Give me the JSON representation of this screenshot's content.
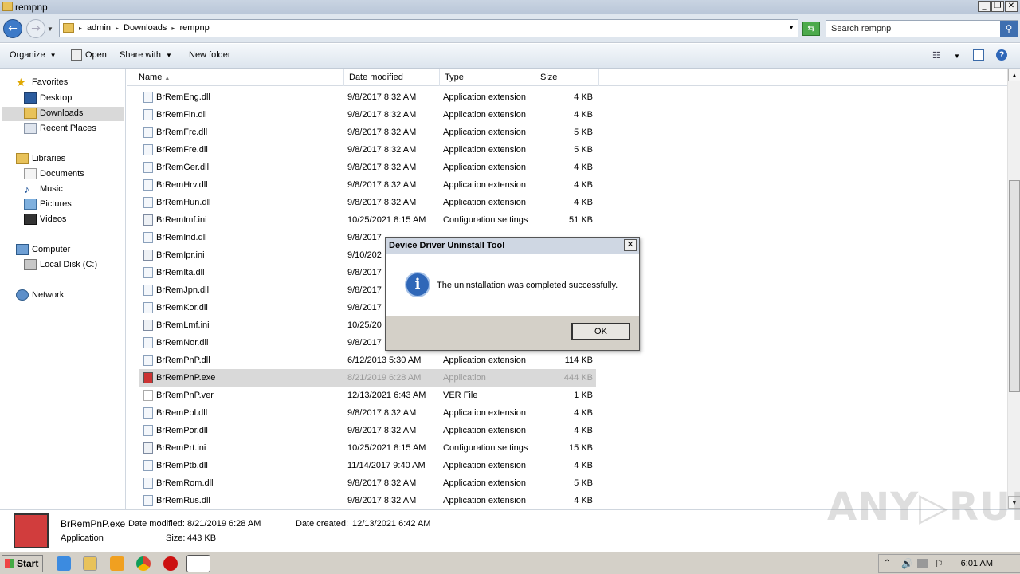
{
  "window": {
    "title": "rempnp",
    "controls": {
      "minimize": "_",
      "maximize": "❐",
      "close": "✕"
    }
  },
  "address": {
    "crumbs": [
      "admin",
      "Downloads",
      "rempnp"
    ],
    "search_placeholder": "Search rempnp"
  },
  "toolbar": {
    "organize": "Organize",
    "open": "Open",
    "share_with": "Share with",
    "new_folder": "New folder"
  },
  "sidebar": {
    "favorites": "Favorites",
    "desktop": "Desktop",
    "downloads": "Downloads",
    "recent": "Recent Places",
    "libraries": "Libraries",
    "documents": "Documents",
    "music": "Music",
    "pictures": "Pictures",
    "videos": "Videos",
    "computer": "Computer",
    "local_disk": "Local Disk (C:)",
    "network": "Network"
  },
  "columns": {
    "name": "Name",
    "date": "Date modified",
    "type": "Type",
    "size": "Size"
  },
  "files": [
    {
      "name": "BrRemEng.dll",
      "date": "9/8/2017 8:32 AM",
      "type": "Application extension",
      "size": "4 KB"
    },
    {
      "name": "BrRemFin.dll",
      "date": "9/8/2017 8:32 AM",
      "type": "Application extension",
      "size": "4 KB"
    },
    {
      "name": "BrRemFrc.dll",
      "date": "9/8/2017 8:32 AM",
      "type": "Application extension",
      "size": "5 KB"
    },
    {
      "name": "BrRemFre.dll",
      "date": "9/8/2017 8:32 AM",
      "type": "Application extension",
      "size": "5 KB"
    },
    {
      "name": "BrRemGer.dll",
      "date": "9/8/2017 8:32 AM",
      "type": "Application extension",
      "size": "4 KB"
    },
    {
      "name": "BrRemHrv.dll",
      "date": "9/8/2017 8:32 AM",
      "type": "Application extension",
      "size": "4 KB"
    },
    {
      "name": "BrRemHun.dll",
      "date": "9/8/2017 8:32 AM",
      "type": "Application extension",
      "size": "4 KB"
    },
    {
      "name": "BrRemImf.ini",
      "date": "10/25/2021 8:15 AM",
      "type": "Configuration settings",
      "size": "51 KB"
    },
    {
      "name": "BrRemInd.dll",
      "date": "9/8/2017",
      "type": "",
      "size": ""
    },
    {
      "name": "BrRemIpr.ini",
      "date": "9/10/202",
      "type": "",
      "size": ""
    },
    {
      "name": "BrRemIta.dll",
      "date": "9/8/2017",
      "type": "",
      "size": ""
    },
    {
      "name": "BrRemJpn.dll",
      "date": "9/8/2017",
      "type": "",
      "size": ""
    },
    {
      "name": "BrRemKor.dll",
      "date": "9/8/2017",
      "type": "",
      "size": ""
    },
    {
      "name": "BrRemLmf.ini",
      "date": "10/25/20",
      "type": "",
      "size": ""
    },
    {
      "name": "BrRemNor.dll",
      "date": "9/8/2017",
      "type": "",
      "size": ""
    },
    {
      "name": "BrRemPnP.dll",
      "date": "6/12/2013 5:30 AM",
      "type": "Application extension",
      "size": "114 KB"
    },
    {
      "name": "BrRemPnP.exe",
      "date": "8/21/2019 6:28 AM",
      "type": "Application",
      "size": "444 KB"
    },
    {
      "name": "BrRemPnP.ver",
      "date": "12/13/2021 6:43 AM",
      "type": "VER File",
      "size": "1 KB"
    },
    {
      "name": "BrRemPol.dll",
      "date": "9/8/2017 8:32 AM",
      "type": "Application extension",
      "size": "4 KB"
    },
    {
      "name": "BrRemPor.dll",
      "date": "9/8/2017 8:32 AM",
      "type": "Application extension",
      "size": "4 KB"
    },
    {
      "name": "BrRemPrt.ini",
      "date": "10/25/2021 8:15 AM",
      "type": "Configuration settings",
      "size": "15 KB"
    },
    {
      "name": "BrRemPtb.dll",
      "date": "11/14/2017 9:40 AM",
      "type": "Application extension",
      "size": "4 KB"
    },
    {
      "name": "BrRemRom.dll",
      "date": "9/8/2017 8:32 AM",
      "type": "Application extension",
      "size": "5 KB"
    },
    {
      "name": "BrRemRus.dll",
      "date": "9/8/2017 8:32 AM",
      "type": "Application extension",
      "size": "4 KB"
    }
  ],
  "details": {
    "filename": "BrRemPnP.exe",
    "type": "Application",
    "modified_label": "Date modified:",
    "modified_value": "8/21/2019 6:28 AM",
    "size_label": "Size:",
    "size_value": "443 KB",
    "created_label": "Date created:",
    "created_value": "12/13/2021 6:42 AM"
  },
  "dialog": {
    "title": "Device Driver Uninstall Tool",
    "message": "The uninstallation was completed successfully.",
    "ok": "OK",
    "close": "✕",
    "info_glyph": "i"
  },
  "taskbar": {
    "start": "Start",
    "clock": "6:01 AM"
  },
  "watermark": "ANY▷RUN"
}
